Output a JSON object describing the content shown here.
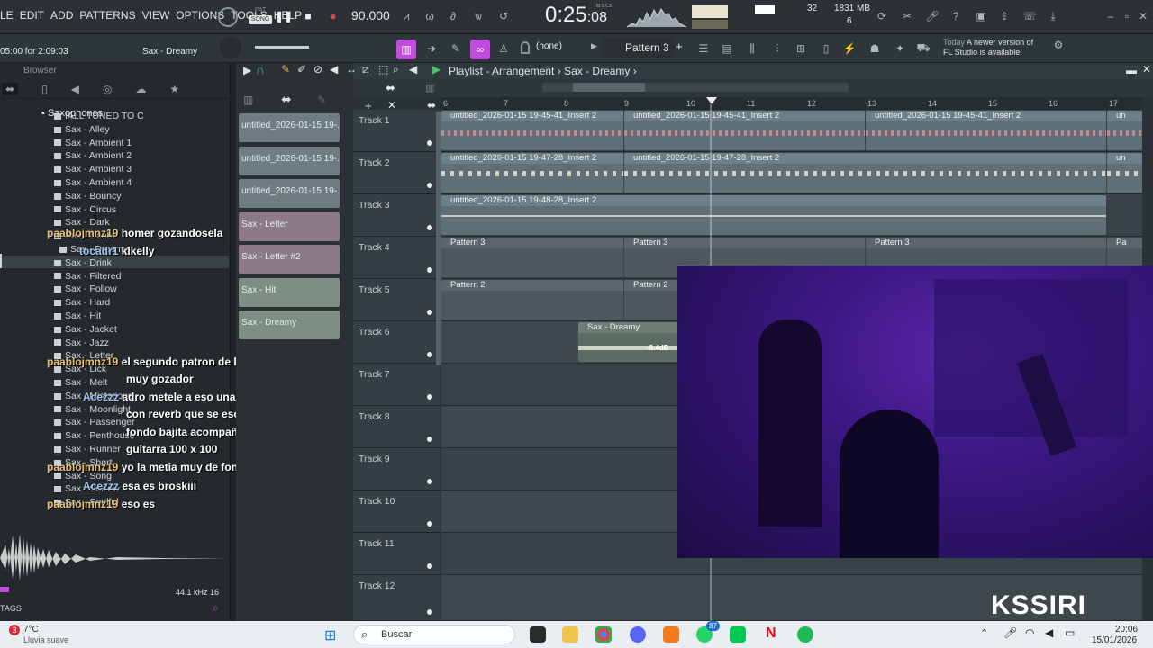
{
  "menu": {
    "items": [
      "LE",
      "EDIT",
      "ADD",
      "PATTERNS",
      "VIEW",
      "OPTIONS",
      "TOOLS",
      "HELP"
    ]
  },
  "transport": {
    "song_mode": "SONG",
    "pat_mode": "PAT",
    "tempo": "90.000",
    "time": "0:25",
    "time_sub": ":08",
    "time_unit": "M:S:CS"
  },
  "cpu": {
    "value": "32",
    "memory": "1831 MB",
    "polyphony": "6"
  },
  "hint_bar": {
    "line1": "05:00 for 2:09:03",
    "line2": "Sax - Dreamy"
  },
  "toolbar2": {
    "snap": "(none)",
    "pattern": "Pattern 3"
  },
  "news": {
    "label": "Today",
    "line1": "A newer version of",
    "line2": "FL Studio is available!"
  },
  "browser": {
    "title": "Browser",
    "folder": "Saxophones",
    "items": [
      "IALL TUNED TO C",
      "Sax - Alley",
      "Sax - Ambient 1",
      "Sax - Ambient 2",
      "Sax - Ambient 3",
      "Sax - Ambient 4",
      "Sax - Bouncy",
      "Sax - Circus",
      "Sax - Dark",
      "Sax - Doubt",
      "Sax - Dreamy",
      "Sax - Drink",
      "Sax - Filtered",
      "Sax - Follow",
      "Sax - Hard",
      "Sax - Hit",
      "Sax - Jacket",
      "Sax - Jazz",
      "Sax - Letter",
      "Sax - Lick",
      "Sax - Melt",
      "Sax - Misterious",
      "Sax - Moonlight",
      "Sax - Passenger",
      "Sax - Penthouse",
      "Sax - Runner",
      "Sax - Short",
      "Sax - Song",
      "Sax - Sorrow",
      "Sax - Soulful"
    ],
    "selected_index": 10,
    "sample_info": "44.1 kHz 16",
    "tags_label": "TAGS"
  },
  "chat": [
    {
      "user": "paablojmnz19",
      "text": "homer gozandosela"
    },
    {
      "user": "tocadr1",
      "text": "klkelly"
    },
    {
      "user": "paablojmnz19",
      "text": "el segundo patron de la guitarra es"
    },
    {
      "user": "",
      "text": "muy gozador"
    },
    {
      "user": "Acezzz",
      "text": "adro metele a eso una trompeta"
    },
    {
      "user": "",
      "text": "con reverb que se escuche de"
    },
    {
      "user": "",
      "text": "fondo bajita acompañando la"
    },
    {
      "user": "",
      "text": "guitarra 100 x 100"
    },
    {
      "user": "paablojmnz19",
      "text": "yo la metia muy de fondo"
    },
    {
      "user": "Acezzz",
      "text": "esa es broskiii"
    },
    {
      "user": "paablojmnz19",
      "text": "eso es"
    }
  ],
  "picker": [
    "untitled_2026-01-15 19-...",
    "untitled_2026-01-15 19-...",
    "untitled_2026-01-15 19-...",
    "Sax - Letter",
    "Sax - Letter #2",
    "Sax - Hit",
    "Sax - Dreamy"
  ],
  "playlist": {
    "title": "Playlist - Arrangement",
    "pattern": "Sax - Dreamy",
    "bars": [
      "6",
      "7",
      "8",
      "9",
      "10",
      "11",
      "12",
      "13",
      "14",
      "15",
      "16",
      "17"
    ],
    "tracks": [
      "Track 1",
      "Track 2",
      "Track 3",
      "Track 4",
      "Track 5",
      "Track 6",
      "Track 7",
      "Track 8",
      "Track 9",
      "Track 10",
      "Track 11",
      "Track 12"
    ],
    "clips": {
      "t1": [
        "untitled_2026-01-15 19-45-41_Insert 2",
        "untitled_2026-01-15 19-45-41_Insert 2",
        "untitled_2026-01-15 19-45-41_Insert 2",
        "un"
      ],
      "t2": [
        "untitled_2026-01-15 19-47-28_Insert 2",
        "untitled_2026-01-15 19-47-28_Insert 2",
        "un"
      ],
      "t3": [
        "untitled_2026-01-15 19-48-28_Insert 2"
      ],
      "t4": [
        "Pattern 3",
        "Pattern 3",
        "Pattern 3",
        "Pa"
      ],
      "t5": [
        "Pattern 2",
        "Pattern 2"
      ],
      "t6": [
        "Sax - Dreamy"
      ],
      "t6_gain": "-9.4dB"
    }
  },
  "taskbar": {
    "weather_temp": "7°C",
    "weather_desc": "Lluvia suave",
    "search": "Buscar",
    "time": "20:06",
    "date": "15/01/2026",
    "badge1": "3",
    "badge2": "87"
  },
  "overlay_logo": "KSSIRI"
}
